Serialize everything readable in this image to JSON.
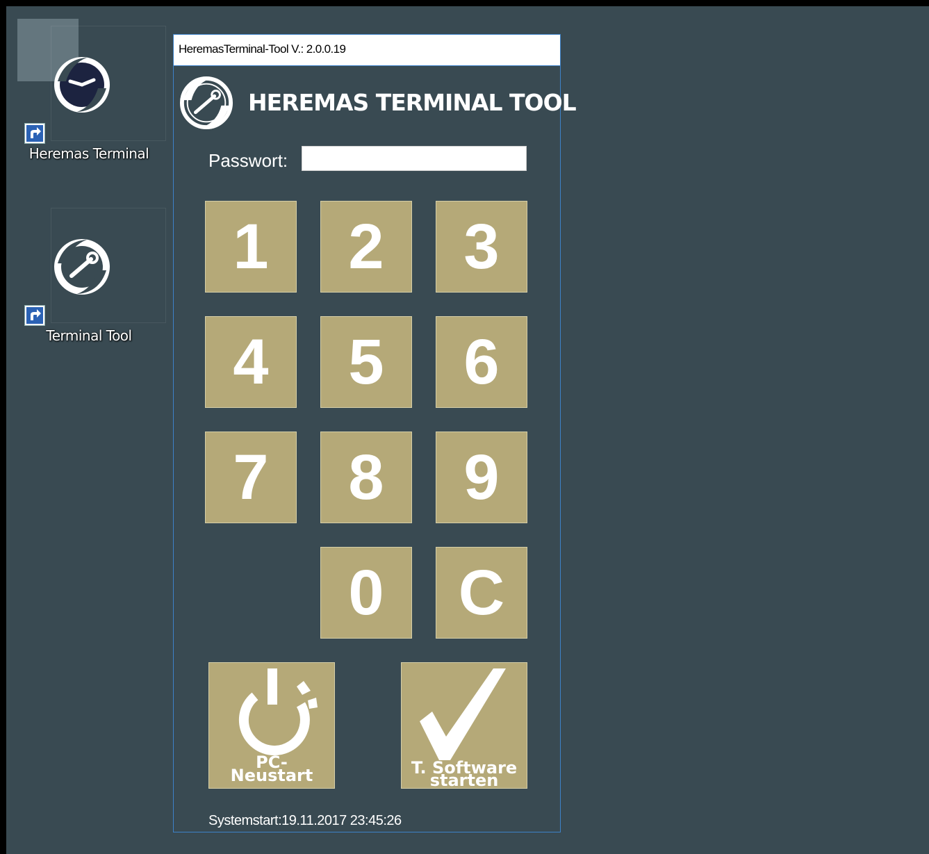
{
  "desktop": {
    "icons": [
      {
        "label": "Heremas Terminal",
        "icon": "heremas-clock-icon"
      },
      {
        "label": "Terminal Tool",
        "icon": "heremas-wrench-icon"
      }
    ]
  },
  "window": {
    "title": "HeremasTerminal-Tool V.: 2.0.0.19",
    "header_title": "HEREMAS TERMINAL TOOL",
    "password_label": "Passwort:",
    "password_value": "",
    "keypad": [
      "1",
      "2",
      "3",
      "4",
      "5",
      "6",
      "7",
      "8",
      "9",
      "0",
      "C"
    ],
    "restart_line1": "PC-",
    "restart_line2": "Neustart",
    "start_line1": "T. Software",
    "start_line2": "starten",
    "systemstart": "Systemstart:19.11.2017 23:45:26"
  },
  "colors": {
    "desktop_bg": "#394a52",
    "key_bg": "#b5a978",
    "window_border": "#3d82c9"
  }
}
